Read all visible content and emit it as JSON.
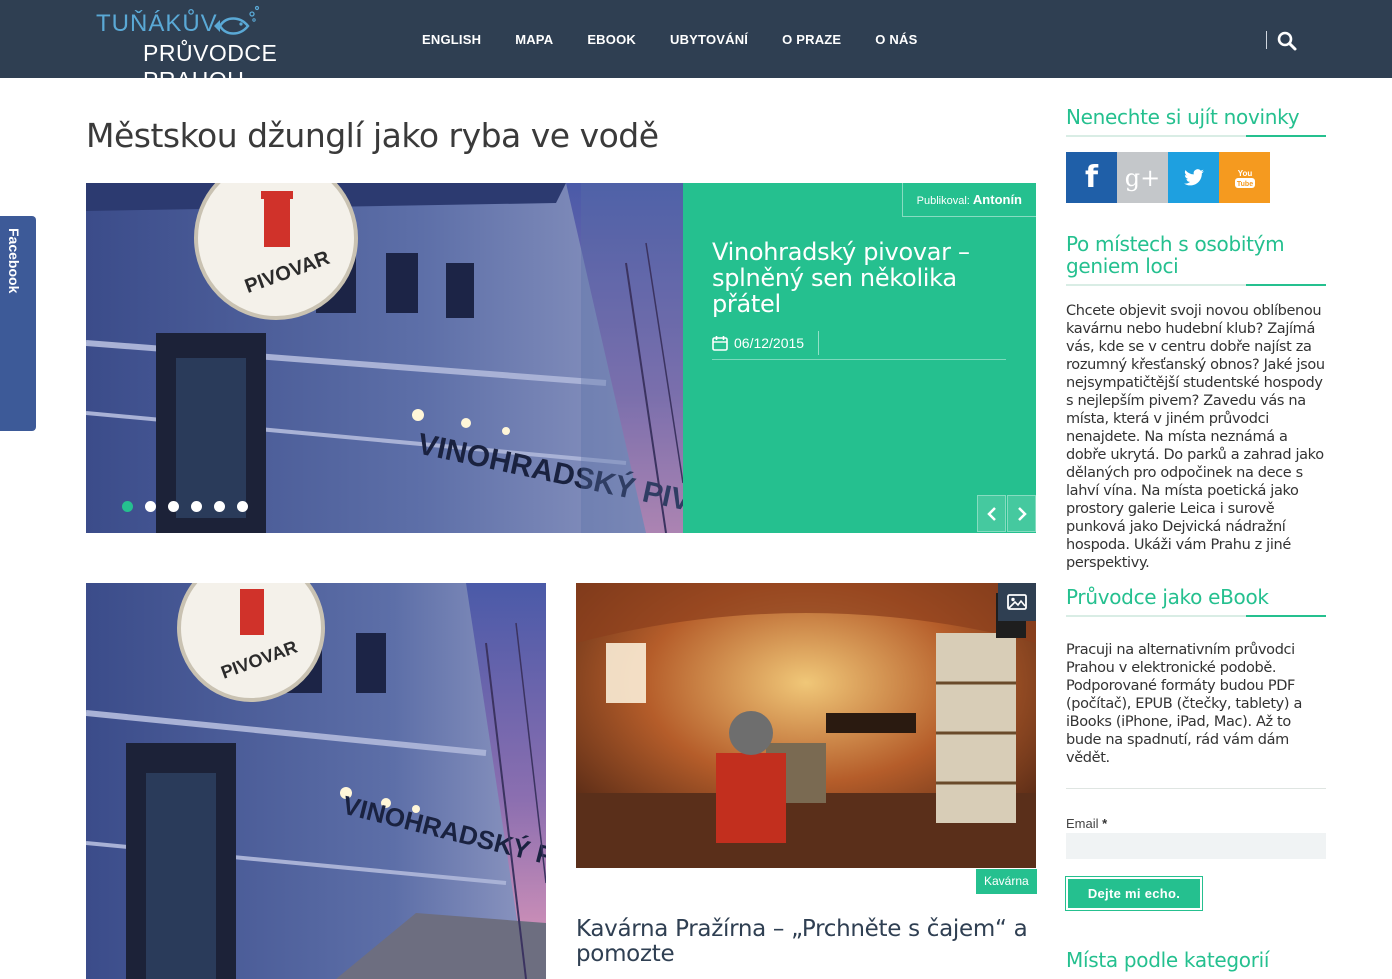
{
  "header": {
    "logo_line1": "TUŇÁKŮV",
    "logo_line2": "PRŮVODCE PRAHOU",
    "nav": [
      "ENGLISH",
      "MAPA",
      "EBOOK",
      "UBYTOVÁNÍ",
      "O PRAZE",
      "O NÁS"
    ],
    "search_icon": "search-icon"
  },
  "facebook_tab": {
    "label": "Facebook"
  },
  "main": {
    "page_title": "Městskou džunglí jako ryba ve vodě",
    "slider": {
      "author_label": "Publikoval:",
      "author_name": "Antonín",
      "title": "Vinohradský pivovar – splněný sen několika přátel",
      "date": "06/12/2015",
      "dots_count": 6,
      "active_dot": 0,
      "image_sign_top": "VINOHRADSKÝ",
      "image_sign_bottom": "PIVOVAR",
      "image_facade_text": "VINOHRADSKÝ PIVOVAR"
    },
    "post2": {
      "category": "Kavárna",
      "title": "Kavárna Pražírna – „Prchněte s čajem“ a pomozte",
      "icon": "image-icon"
    }
  },
  "sidebar": {
    "news_heading": "Nenechte si ujít novinky",
    "social": [
      "facebook",
      "google-plus",
      "twitter",
      "youtube"
    ],
    "social_labels": {
      "fb": "f",
      "gp": "g+",
      "yt_top": "You",
      "yt_bottom": "Tube"
    },
    "genius_heading": "Po místech s osobitým geniem loci",
    "genius_text": "Chcete objevit svoji novou oblíbenou kavárnu nebo hudební klub? Zajímá vás, kde se v centru dobře najíst za rozumný křesťanský obnos? Jaké jsou nejsympatičtější studentské hospody s nejlepším pivem? Zavedu vás na místa, která v jiném průvodci nenajdete. Na místa neznámá a dobře ukrytá. Do parků a zahrad jako dělaných pro odpočinek na dece s lahví vína. Na místa poetická jako prostory galerie Leica i surově punková jako Dejvická nádražní hospoda. Ukáži vám Prahu z jiné perspektivy.",
    "ebook_heading": "Průvodce jako eBook",
    "ebook_text": "Pracuji na alternativním průvodci Prahou v elektronické podobě. Podporované formáty budou PDF (počítač), EPUB (čtečky, tablety) a iBooks (iPhone, iPad, Mac). Až to bude na spadnutí, rád vám dám vědět.",
    "email_label": "Email",
    "email_required": "*",
    "email_value": "",
    "submit_label": "Dejte mi echo.",
    "categories_heading": "Místa podle kategorií"
  },
  "colors": {
    "header_bg": "#2f3f52",
    "accent": "#25c08f",
    "facebook_blue": "#3d5a98"
  }
}
